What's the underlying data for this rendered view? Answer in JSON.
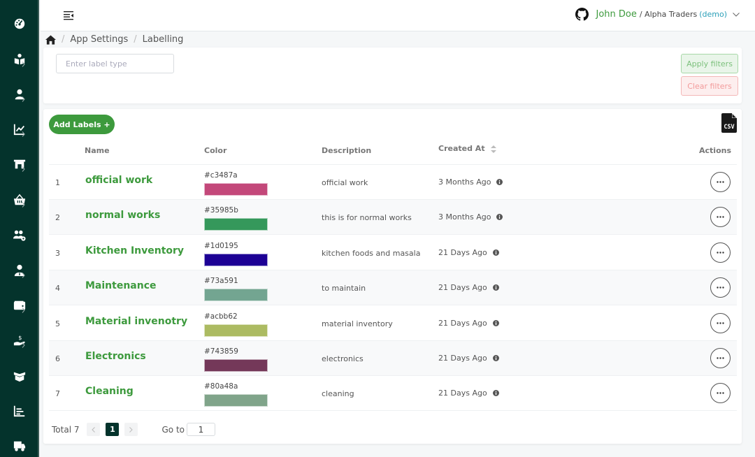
{
  "sidebar": {
    "items": [
      {
        "icon": "dashboard-gauge-icon",
        "has_submenu": false
      },
      {
        "icon": "book-reader-icon",
        "has_submenu": true
      },
      {
        "icon": "user-icon",
        "has_submenu": true
      },
      {
        "icon": "chart-line-icon",
        "has_submenu": true
      },
      {
        "icon": "store-icon",
        "has_submenu": true
      },
      {
        "icon": "basket-icon",
        "has_submenu": true
      },
      {
        "icon": "users-cog-icon",
        "has_submenu": false
      },
      {
        "icon": "user-tie-icon",
        "has_submenu": true
      },
      {
        "icon": "wallet-icon",
        "has_submenu": true
      },
      {
        "icon": "hand-dollar-icon",
        "has_submenu": true
      },
      {
        "icon": "box-open-icon",
        "has_submenu": false
      },
      {
        "icon": "bar-chart-list-icon",
        "has_submenu": false
      },
      {
        "icon": "truck-icon",
        "has_submenu": false
      }
    ]
  },
  "header": {
    "user_name": "John Doe",
    "org_separator": "/ Alpha Traders",
    "org_tag": "(demo)"
  },
  "breadcrumb": {
    "items": [
      "App Settings",
      "Labelling"
    ],
    "separator": "/"
  },
  "filters": {
    "label_type_placeholder": "Enter label type",
    "label_type_value": "",
    "apply_label": "Apply filters",
    "clear_label": "Clear filters"
  },
  "toolbar": {
    "add_label": "Add Labels +",
    "export_format": "CSV"
  },
  "table": {
    "columns": {
      "name": "Name",
      "color": "Color",
      "description": "Description",
      "created_at": "Created At",
      "actions": "Actions"
    },
    "rows": [
      {
        "index": "1",
        "name": "official work",
        "color_hex": "#c3487a",
        "description": "official work",
        "created_at": "3 Months Ago"
      },
      {
        "index": "2",
        "name": "normal works",
        "color_hex": "#35985b",
        "description": "this is for normal works",
        "created_at": "3 Months Ago"
      },
      {
        "index": "3",
        "name": "Kitchen Inventory",
        "color_hex": "#1d0195",
        "description": "kitchen foods and masala",
        "created_at": "21 Days Ago"
      },
      {
        "index": "4",
        "name": "Maintenance",
        "color_hex": "#73a591",
        "description": "to maintain",
        "created_at": "21 Days Ago"
      },
      {
        "index": "5",
        "name": "Material invenotry",
        "color_hex": "#acbb62",
        "description": "material inventory",
        "created_at": "21 Days Ago"
      },
      {
        "index": "6",
        "name": "Electronics",
        "color_hex": "#743859",
        "description": "electronics",
        "created_at": "21 Days Ago"
      },
      {
        "index": "7",
        "name": "Cleaning",
        "color_hex": "#80a48a",
        "description": "cleaning",
        "created_at": "21 Days Ago"
      }
    ]
  },
  "pagination": {
    "total_label": "Total 7",
    "current_page": "1",
    "goto_label": "Go to",
    "goto_value": "1"
  },
  "theme": {
    "sidebar_bg": "#04332c",
    "accent_green": "#3d9a3d",
    "demo_blue": "#2a9fb8"
  }
}
